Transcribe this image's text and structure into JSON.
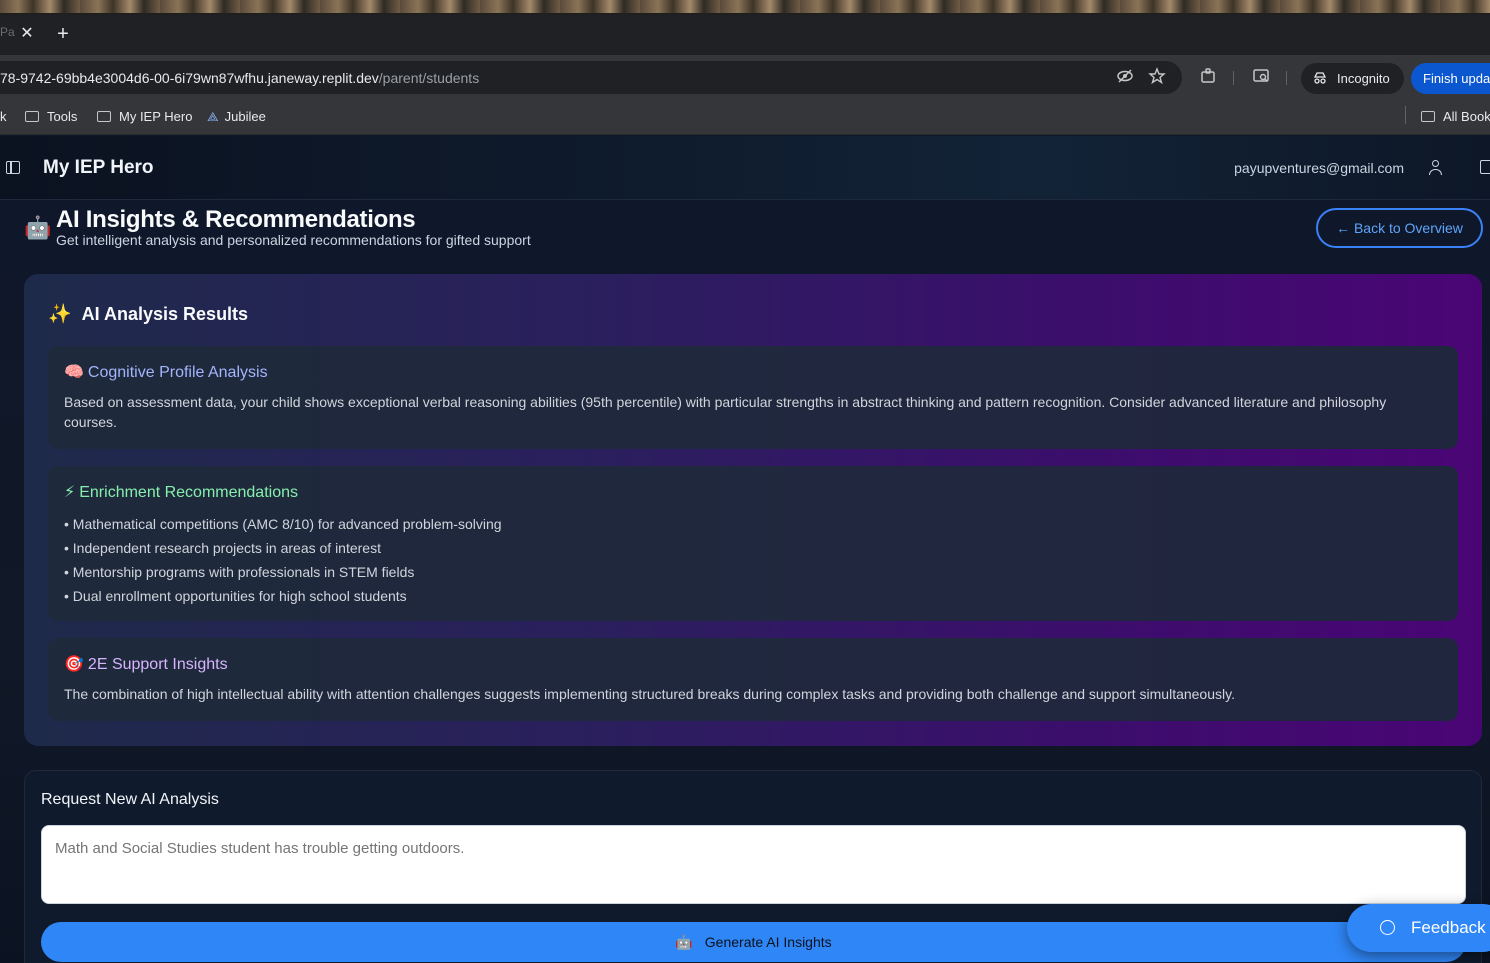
{
  "browser": {
    "tab_ghost": "Pa",
    "tab_close_glyph": "✕",
    "new_tab_glyph": "+",
    "url_host": "78-9742-69bb4e3004d6-00-6i79wn87wfhu.janeway.replit.dev",
    "url_path": "/parent/students",
    "incognito_label": "Incognito",
    "update_label": "Finish upda",
    "bookmarks": [
      {
        "label": "k"
      },
      {
        "label": "Tools"
      },
      {
        "label": "My IEP Hero"
      },
      {
        "label": "Jubilee"
      }
    ],
    "all_bookmarks_label": "All Book"
  },
  "header": {
    "app_title": "My IEP Hero",
    "user_email": "payupventures@gmail.com"
  },
  "page": {
    "icon_emoji": "🤖",
    "title": "AI Insights & Recommendations",
    "subtitle": "Get intelligent analysis and personalized recommendations for gifted support",
    "back_label": "← Back to Overview"
  },
  "results": {
    "icon_emoji": "✨",
    "title": "AI Analysis Results",
    "cognitive": {
      "emoji": "🧠",
      "title": "Cognitive Profile Analysis",
      "title_color": "#a5b4fc",
      "text": "Based on assessment data, your child shows exceptional verbal reasoning abilities (95th percentile) with particular strengths in abstract thinking and pattern recognition. Consider advanced literature and philosophy courses."
    },
    "enrichment": {
      "emoji": "⚡",
      "title": "Enrichment Recommendations",
      "title_color": "#86efac",
      "items": [
        "• Mathematical competitions (AMC 8/10) for advanced problem-solving",
        "• Independent research projects in areas of interest",
        "• Mentorship programs with professionals in STEM fields",
        "• Dual enrollment opportunities for high school students"
      ]
    },
    "support": {
      "emoji": "🎯",
      "title": "2E Support Insights",
      "title_color": "#d8b4fe",
      "text": "The combination of high intellectual ability with attention challenges suggests implementing structured breaks during complex tasks and providing both challenge and support simultaneously."
    }
  },
  "request": {
    "title": "Request New AI Analysis",
    "placeholder": "Math and Social Studies student has trouble getting outdoors.",
    "button_emoji": "🤖",
    "button_label": "Generate AI Insights"
  },
  "feedback": {
    "label": "Feedback"
  },
  "colors": {
    "accent_blue": "#2f86f6",
    "page_bg": "#0f172a"
  }
}
